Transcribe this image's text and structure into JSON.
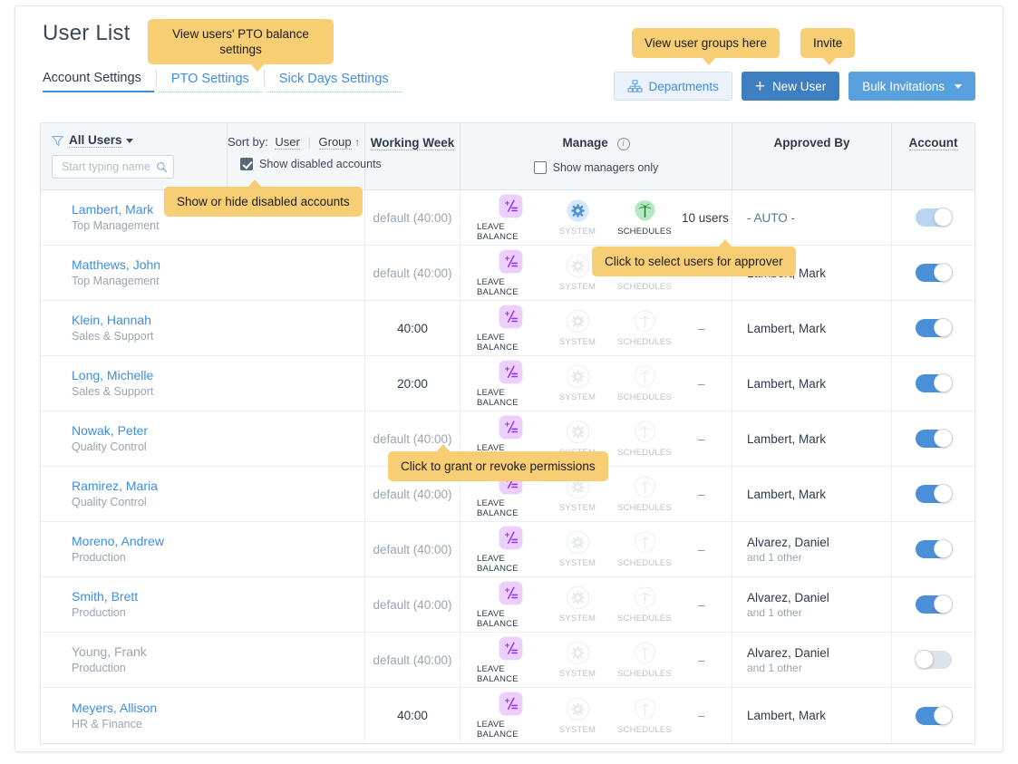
{
  "header": {
    "title": "User List",
    "tabs": [
      {
        "label": "Account Settings",
        "active": true
      },
      {
        "label": "PTO Settings",
        "active": false
      },
      {
        "label": "Sick Days Settings",
        "active": false
      }
    ]
  },
  "actions": {
    "departments": "Departments",
    "new_user": "New User",
    "new_user_plus": "+",
    "bulk_invitations": "Bulk Invitations"
  },
  "tooltips": {
    "pto": "View users' PTO balance settings",
    "groups": "View user groups here",
    "invite": "Invite",
    "disabled": "Show or hide disabled accounts",
    "approver": "Click to select users for approver",
    "permissions": "Click to grant or revoke permissions"
  },
  "table_header": {
    "filter_label": "All Users",
    "search_placeholder": "Start typing name",
    "search_value": "",
    "sort_prefix": "Sort by:",
    "sort_user": "User",
    "sort_group": "Group",
    "sort_arrow": "↑",
    "show_disabled": "Show disabled accounts",
    "show_disabled_checked": true,
    "working_week": "Working Week",
    "manage": "Manage",
    "show_managers_only": "Show managers only",
    "show_managers_only_checked": false,
    "approved_by": "Approved By",
    "account": "Account"
  },
  "manage_labels": {
    "leave_balance": "LEAVE BALANCE",
    "system": "SYSTEM",
    "schedules": "SCHEDULES"
  },
  "colors": {
    "accent": "#3f8de0",
    "tooltip": "#f7ce73",
    "leave_balance": "#a855f7",
    "system": "#4a90d9",
    "schedules": "#34a853"
  },
  "rows": [
    {
      "name": "Lambert, Mark",
      "dept": "Top Management",
      "disabled": false,
      "week": "default (40:00)",
      "week_default": true,
      "leave_balance": "on",
      "system": "on",
      "schedules": "on",
      "extra": "10 users",
      "approved_by": "- AUTO -",
      "approved_sub": "",
      "approved_auto": true,
      "account": "on-faded"
    },
    {
      "name": "Matthews, John",
      "dept": "Top Management",
      "disabled": false,
      "week": "default (40:00)",
      "week_default": true,
      "leave_balance": "on",
      "system": "off",
      "schedules": "off",
      "extra": "",
      "approved_by": "Lambert, Mark",
      "approved_sub": "",
      "approved_auto": false,
      "account": "on"
    },
    {
      "name": "Klein, Hannah",
      "dept": "Sales & Support",
      "disabled": false,
      "week": "40:00",
      "week_default": false,
      "leave_balance": "on",
      "system": "off",
      "schedules": "off",
      "extra": "–",
      "approved_by": "Lambert, Mark",
      "approved_sub": "",
      "approved_auto": false,
      "account": "on"
    },
    {
      "name": "Long, Michelle",
      "dept": "Sales & Support",
      "disabled": false,
      "week": "20:00",
      "week_default": false,
      "leave_balance": "on",
      "system": "off",
      "schedules": "off",
      "extra": "–",
      "approved_by": "Lambert, Mark",
      "approved_sub": "",
      "approved_auto": false,
      "account": "on"
    },
    {
      "name": "Nowak, Peter",
      "dept": "Quality Control",
      "disabled": false,
      "week": "default (40:00)",
      "week_default": true,
      "leave_balance": "on",
      "system": "off",
      "schedules": "off",
      "extra": "–",
      "approved_by": "Lambert, Mark",
      "approved_sub": "",
      "approved_auto": false,
      "account": "on"
    },
    {
      "name": "Ramirez, Maria",
      "dept": "Quality Control",
      "disabled": false,
      "week": "default (40:00)",
      "week_default": true,
      "leave_balance": "on",
      "system": "off",
      "schedules": "off",
      "extra": "–",
      "approved_by": "Lambert, Mark",
      "approved_sub": "",
      "approved_auto": false,
      "account": "on"
    },
    {
      "name": "Moreno, Andrew",
      "dept": "Production",
      "disabled": false,
      "week": "default (40:00)",
      "week_default": true,
      "leave_balance": "on",
      "system": "off",
      "schedules": "off",
      "extra": "–",
      "approved_by": "Alvarez, Daniel",
      "approved_sub": "and 1 other",
      "approved_auto": false,
      "account": "on"
    },
    {
      "name": "Smith, Brett",
      "dept": "Production",
      "disabled": false,
      "week": "default (40:00)",
      "week_default": true,
      "leave_balance": "on",
      "system": "off",
      "schedules": "off",
      "extra": "–",
      "approved_by": "Alvarez, Daniel",
      "approved_sub": "and 1 other",
      "approved_auto": false,
      "account": "on"
    },
    {
      "name": "Young, Frank",
      "dept": "Production",
      "disabled": true,
      "week": "default (40:00)",
      "week_default": true,
      "leave_balance": "on",
      "system": "off",
      "schedules": "off",
      "extra": "–",
      "approved_by": "Alvarez, Daniel",
      "approved_sub": "and 1 other",
      "approved_auto": false,
      "account": "off"
    },
    {
      "name": "Meyers, Allison",
      "dept": "HR & Finance",
      "disabled": false,
      "week": "40:00",
      "week_default": false,
      "leave_balance": "on",
      "system": "off",
      "schedules": "off",
      "extra": "–",
      "approved_by": "Lambert, Mark",
      "approved_sub": "",
      "approved_auto": false,
      "account": "on"
    }
  ]
}
